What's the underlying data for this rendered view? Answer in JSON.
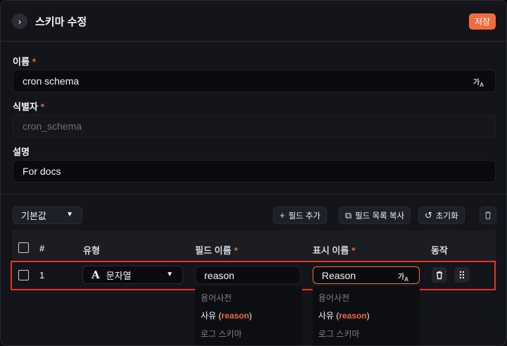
{
  "header": {
    "back_icon": "chevron-right-icon",
    "title": "스키마 수정",
    "save_label": "저장"
  },
  "form": {
    "name_label": "이름",
    "name_value": "cron schema",
    "id_label": "식별자",
    "id_placeholder": "cron_schema",
    "desc_label": "설명",
    "desc_value": "For docs",
    "required_mark": "*",
    "translate_icon_text": "가",
    "translate_icon_sub": "A"
  },
  "toolbar": {
    "default_select": "기본값",
    "add_field": "필드 추가",
    "copy_fields": "필드 목록 복사",
    "reset": "초기화"
  },
  "table": {
    "headers": {
      "index": "#",
      "type": "유형",
      "field_name": "필드 이름",
      "display_name": "표시 이름",
      "actions": "동작"
    },
    "rows": [
      {
        "index": "1",
        "type": "문자열",
        "field_name": "reason",
        "display_name": "Reason"
      }
    ]
  },
  "dropdowns": {
    "field": {
      "heading1": "용어사전",
      "item_prefix": "사유 (",
      "item_highlight": "reason",
      "item_suffix": ")",
      "heading2": "로그 스키마"
    },
    "display": {
      "heading1": "용어사전",
      "item_prefix": "사유 (",
      "item_highlight": "reason",
      "item_suffix": ")",
      "heading2": "로그 스키마"
    }
  },
  "colors": {
    "accent": "#f26a3d",
    "highlight_border": "#e8321f",
    "background": "#14151a"
  }
}
